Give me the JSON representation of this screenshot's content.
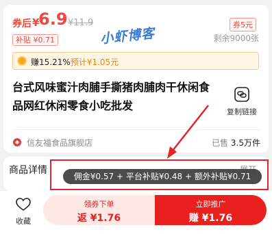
{
  "product": {
    "price_prefix": "券后",
    "currency": "¥",
    "price": "6.9",
    "original_price": "¥11.9",
    "coupon_tag": "券5元",
    "subsidy_tag": "补贴 ¥0.71",
    "stock": "剩余9000张",
    "earn": {
      "rate": "赚15.21%",
      "estimate": "预计¥1.05元"
    },
    "title": "台式风味蜜汁肉脯手撕猪肉脯肉干休闲食品网红休闲零食小吃批发",
    "copy_link_label": "复制链接",
    "shop_name": "信友福食品旗舰店",
    "sold_label": "已售",
    "sold_count": "3.5万件"
  },
  "watermark": "小虾博客",
  "details": {
    "title": "商品详情",
    "expand": "展开"
  },
  "tooltip": {
    "text": "佣金¥0.57 + 平台补贴¥0.48 + 额外补贴¥0.71"
  },
  "bottom_bar": {
    "favorite_label": "收藏",
    "left_button": {
      "top": "领券下单",
      "bottom": "返 ¥1.76"
    },
    "right_button": {
      "top": "立即推广",
      "bottom": "赚 ¥1.76"
    }
  },
  "colors": {
    "brand_red": "#e8211e",
    "price_red": "#f0483c",
    "earn_orange": "#e8860c",
    "annotation_red": "#e0252a"
  }
}
